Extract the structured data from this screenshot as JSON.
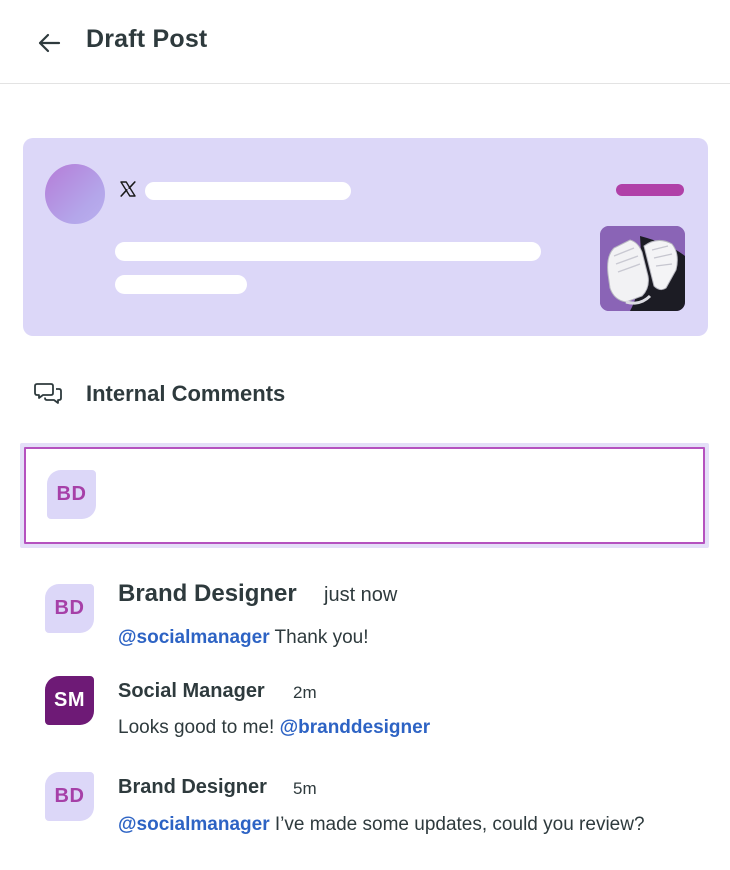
{
  "header": {
    "title": "Draft Post",
    "back_icon": "arrow-left-icon"
  },
  "preview": {
    "platform_icon": "x-logo-icon",
    "thumbnail": "white sneakers on purple background",
    "colors": {
      "card": "#dcd7f8",
      "badge": "#b040a8"
    }
  },
  "comments": {
    "heading": "Internal Comments",
    "heading_icon": "chat-bubbles-icon",
    "compose": {
      "avatar_initials": "BD",
      "value": "",
      "placeholder": ""
    },
    "items": [
      {
        "avatar_initials": "BD",
        "author": "Brand Designer",
        "time": "just now",
        "mention": "@socialmanager",
        "text": " Thank you!"
      },
      {
        "avatar_initials": "SM",
        "author": "Social Manager",
        "time": "2m",
        "text": "Looks good to me! ",
        "mention": "@branddesigner"
      },
      {
        "avatar_initials": "BD",
        "author": "Brand Designer",
        "time": "5m",
        "mention": "@socialmanager",
        "text": " I’ve made some updates, could you review?"
      }
    ]
  },
  "colors": {
    "accent": "#b552bf",
    "mention": "#2d63c4",
    "avatar_bd_bg": "#dcd7f8",
    "avatar_sm_bg": "#6e1a76"
  }
}
